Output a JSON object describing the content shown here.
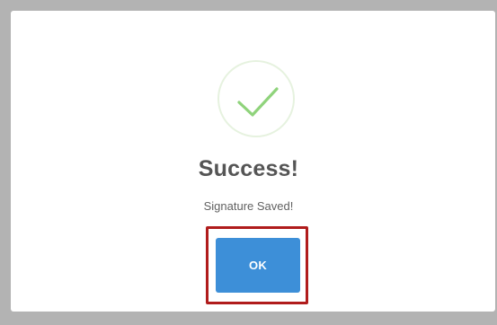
{
  "dialog": {
    "icon": "success-check-icon",
    "title": "Success!",
    "message": "Signature Saved!",
    "ok_label": "OK"
  },
  "colors": {
    "backdrop": "#b3b3b3",
    "check": "#8fd37b",
    "icon_ring": "#e6f2df",
    "button": "#3d8fd8",
    "highlight": "#b01c1c"
  }
}
